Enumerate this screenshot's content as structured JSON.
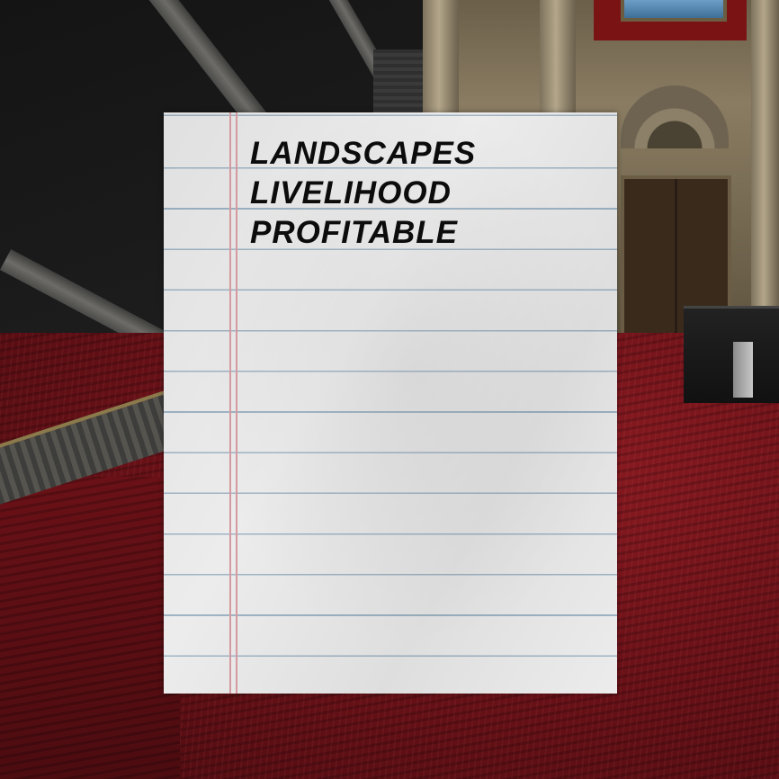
{
  "note": {
    "words": [
      "LANDSCAPES",
      "LIVELIHOOD",
      "PROFITABLE"
    ]
  },
  "colors": {
    "paper": "#ececec",
    "ruled_line": "#9fb4c4",
    "margin_line": "#d49aa0",
    "ink": "#0c0c0c",
    "carpet": "#6b1218"
  }
}
